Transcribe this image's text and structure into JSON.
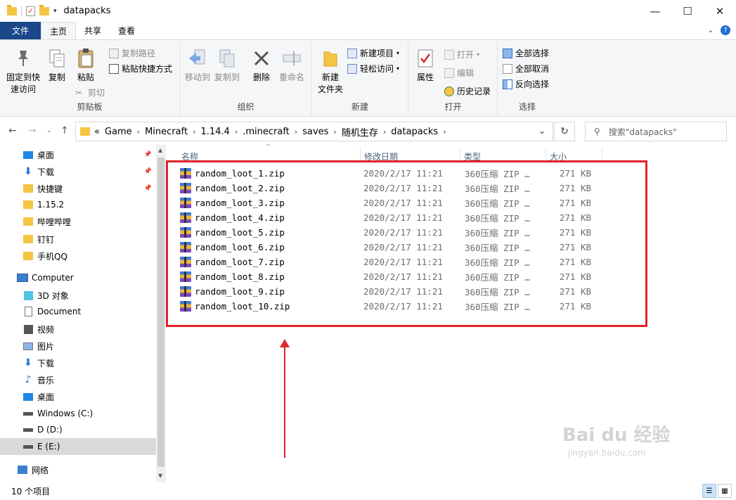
{
  "window": {
    "title": "datapacks",
    "minimize": "—",
    "maximize": "☐",
    "close": "✕"
  },
  "ribbon_tabs": {
    "file": "文件",
    "home": "主页",
    "share": "共享",
    "view": "查看"
  },
  "ribbon": {
    "clipboard": {
      "label": "剪贴板",
      "pin": "固定到快\n速访问",
      "copy": "复制",
      "paste": "粘贴",
      "copy_path": "复制路径",
      "paste_shortcut": "粘贴快捷方式",
      "cut": "剪切"
    },
    "organize": {
      "label": "组织",
      "move_to": "移动到",
      "copy_to": "复制到",
      "delete": "删除",
      "rename": "重命名"
    },
    "new": {
      "label": "新建",
      "new_folder": "新建\n文件夹",
      "new_item": "新建项目",
      "easy_access": "轻松访问"
    },
    "open": {
      "label": "打开",
      "properties": "属性",
      "open": "打开",
      "edit": "编辑",
      "history": "历史记录"
    },
    "select": {
      "label": "选择",
      "select_all": "全部选择",
      "select_none": "全部取消",
      "invert": "反向选择"
    }
  },
  "address": {
    "prefix": "«",
    "crumbs": [
      "Game",
      "Minecraft",
      "1.14.4",
      ".minecraft",
      "saves",
      "随机生存",
      "datapacks"
    ],
    "search_placeholder": "搜索\"datapacks\""
  },
  "nav_pane": {
    "items": [
      {
        "label": "桌面",
        "icon": "desktop-icon",
        "pinned": true
      },
      {
        "label": "下载",
        "icon": "download-icon",
        "pinned": true
      },
      {
        "label": "快捷键",
        "icon": "folder-icon",
        "pinned": true
      },
      {
        "label": "1.15.2",
        "icon": "folder-icon",
        "pinned": false
      },
      {
        "label": "哔哩哔哩",
        "icon": "folder-icon",
        "pinned": false
      },
      {
        "label": "钉钉",
        "icon": "folder-icon",
        "pinned": false
      },
      {
        "label": "手机QQ",
        "icon": "folder-icon",
        "pinned": false
      },
      {
        "label": "Computer",
        "icon": "computer-icon",
        "pinned": false
      },
      {
        "label": "3D 对象",
        "icon": "3d-objects-icon",
        "pinned": false
      },
      {
        "label": "Document",
        "icon": "document-icon",
        "pinned": false
      },
      {
        "label": "视频",
        "icon": "video-icon",
        "pinned": false
      },
      {
        "label": "图片",
        "icon": "picture-icon",
        "pinned": false
      },
      {
        "label": "下载",
        "icon": "download-icon",
        "pinned": false
      },
      {
        "label": "音乐",
        "icon": "music-icon",
        "pinned": false
      },
      {
        "label": "桌面",
        "icon": "desktop-icon",
        "pinned": false
      },
      {
        "label": "Windows (C:)",
        "icon": "drive-icon",
        "pinned": false
      },
      {
        "label": "D (D:)",
        "icon": "drive-icon",
        "pinned": false
      },
      {
        "label": "E (E:)",
        "icon": "drive-icon",
        "pinned": false,
        "selected": true
      },
      {
        "label": "网络",
        "icon": "network-icon",
        "pinned": false
      }
    ]
  },
  "columns": {
    "name": "名称",
    "modified": "修改日期",
    "type": "类型",
    "size": "大小"
  },
  "files": [
    {
      "name": "random_loot_1.zip",
      "modified": "2020/2/17 11:21",
      "type": "360压缩 ZIP …",
      "size": "271 KB"
    },
    {
      "name": "random_loot_2.zip",
      "modified": "2020/2/17 11:21",
      "type": "360压缩 ZIP …",
      "size": "271 KB"
    },
    {
      "name": "random_loot_3.zip",
      "modified": "2020/2/17 11:21",
      "type": "360压缩 ZIP …",
      "size": "271 KB"
    },
    {
      "name": "random_loot_4.zip",
      "modified": "2020/2/17 11:21",
      "type": "360压缩 ZIP …",
      "size": "271 KB"
    },
    {
      "name": "random_loot_5.zip",
      "modified": "2020/2/17 11:21",
      "type": "360压缩 ZIP …",
      "size": "271 KB"
    },
    {
      "name": "random_loot_6.zip",
      "modified": "2020/2/17 11:21",
      "type": "360压缩 ZIP …",
      "size": "271 KB"
    },
    {
      "name": "random_loot_7.zip",
      "modified": "2020/2/17 11:21",
      "type": "360压缩 ZIP …",
      "size": "271 KB"
    },
    {
      "name": "random_loot_8.zip",
      "modified": "2020/2/17 11:21",
      "type": "360压缩 ZIP …",
      "size": "271 KB"
    },
    {
      "name": "random_loot_9.zip",
      "modified": "2020/2/17 11:21",
      "type": "360压缩 ZIP …",
      "size": "271 KB"
    },
    {
      "name": "random_loot_10.zip",
      "modified": "2020/2/17 11:21",
      "type": "360压缩 ZIP …",
      "size": "271 KB"
    }
  ],
  "status": {
    "count": "10 个项目"
  },
  "watermark": {
    "text": "Bai du 经验",
    "sub": "jingyan.baidu.com"
  },
  "colors": {
    "accent": "#19478a",
    "highlight": "#e0242a"
  }
}
